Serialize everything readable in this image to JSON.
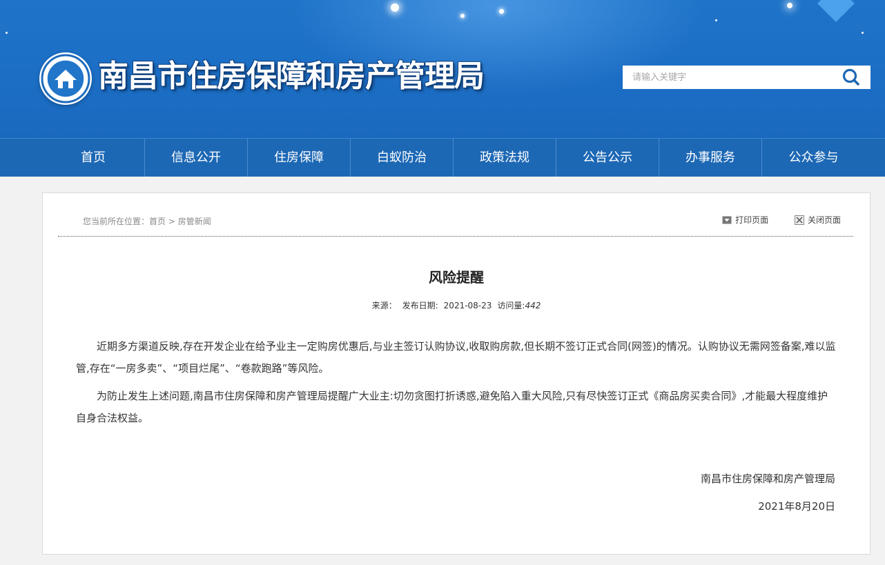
{
  "header": {
    "site_title": "南昌市住房保障和房产管理局",
    "search_placeholder": "请输入关键字"
  },
  "nav": {
    "items": [
      "首页",
      "信息公开",
      "住房保障",
      "白蚁防治",
      "政策法规",
      "公告公示",
      "办事服务",
      "公众参与"
    ]
  },
  "breadcrumb": {
    "prefix": "您当前所在位置：",
    "home": "首页",
    "sep": " > ",
    "current": "房管新闻"
  },
  "tools": {
    "print": "打印页面",
    "close": "关闭页面"
  },
  "article": {
    "title": "风险提醒",
    "source_label": "来源：",
    "date_label": "发布日期:",
    "date": "2021-08-23",
    "visits_label": "访问量:",
    "visits": "442",
    "paragraphs": [
      "近期多方渠道反映,存在开发企业在给予业主一定购房优惠后,与业主签订认购协议,收取购房款,但长期不签订正式合同(网签)的情况。认购协议无需网签备案,难以监管,存在“一房多卖”、“项目烂尾”、“卷款跑路”等风险。",
      "为防止发生上述问题,南昌市住房保障和房产管理局提醒广大业主:切勿贪图打折诱惑,避免陷入重大风险,只有尽快签订正式《商品房买卖合同》,才能最大程度维护自身合法权益。"
    ],
    "signature": "南昌市住房保障和房产管理局",
    "sign_date": "2021年8月20日"
  },
  "colors": {
    "header_blue": "#1f74c9",
    "nav_blue": "#1d68b5",
    "page_bg": "#f2f2f2"
  }
}
